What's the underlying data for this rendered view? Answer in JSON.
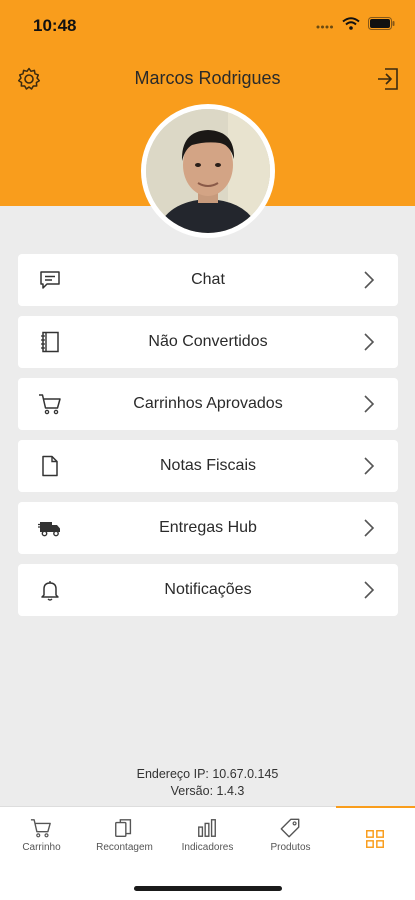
{
  "status_bar": {
    "time": "10:48"
  },
  "header": {
    "user_name": "Marcos Rodrigues",
    "background_color": "#f99d1c",
    "settings_icon": "gear-icon",
    "logout_icon": "logout-icon"
  },
  "menu": {
    "items": [
      {
        "label": "Chat",
        "icon": "chat-icon"
      },
      {
        "label": "Não Convertidos",
        "icon": "notebook-icon"
      },
      {
        "label": "Carrinhos Aprovados",
        "icon": "cart-icon"
      },
      {
        "label": "Notas Fiscais",
        "icon": "document-icon"
      },
      {
        "label": "Entregas Hub",
        "icon": "truck-icon"
      },
      {
        "label": "Notificações",
        "icon": "bell-icon"
      }
    ]
  },
  "footer": {
    "ip": "Endereço IP: 10.67.0.145",
    "version": "Versão: 1.4.3"
  },
  "tabbar": {
    "tabs": [
      {
        "label": "Carrinho",
        "icon": "cart-icon"
      },
      {
        "label": "Recontagem",
        "icon": "copy-icon"
      },
      {
        "label": "Indicadores",
        "icon": "bar-chart-icon"
      },
      {
        "label": "Produtos",
        "icon": "tag-icon"
      },
      {
        "label": "",
        "icon": "grid-icon",
        "active": true
      }
    ],
    "accent_color": "#f99d1c"
  }
}
